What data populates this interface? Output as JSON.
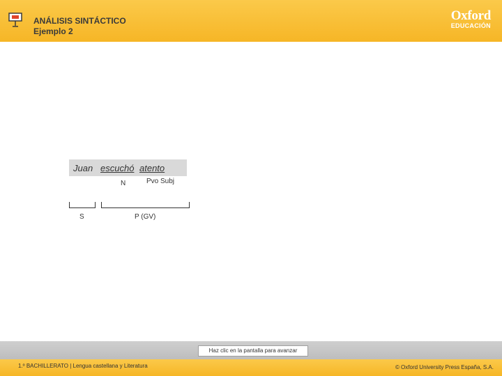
{
  "header": {
    "title": "ANÁLISIS SINTÁCTICO",
    "subtitle": "Ejemplo 2",
    "brand_name": "Oxford",
    "brand_sub": "EDUCACIÓN",
    "icon": "presentation-board-icon"
  },
  "sentence": {
    "words": [
      "Juan",
      "escuchó",
      "atento"
    ]
  },
  "analysis": {
    "nucleus": "N",
    "predicativo": "Pvo Subj",
    "subject": "S",
    "predicate": "P (GV)"
  },
  "footer": {
    "advance_label": "Haz clic en la pantalla para avanzar",
    "course": "1.º BACHILLERATO | Lengua castellana y Literatura",
    "copyright": "© Oxford University Press España, S.A."
  },
  "colors": {
    "header": "#f6b626",
    "footer_bar": "#c4c4c4",
    "sentence_highlight": "#d9d9d9"
  }
}
